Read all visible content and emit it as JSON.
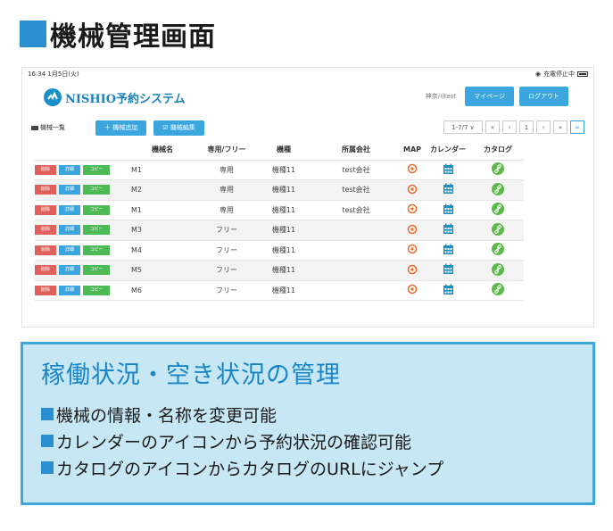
{
  "page_title": "機械管理画面",
  "statusbar": {
    "time": "16:34",
    "date": "1月5日(火)",
    "status": "充電停止中"
  },
  "app": {
    "logo_text": "NISHIO予約システム",
    "user": "神奈川test",
    "mypage_label": "マイページ",
    "logout_label": "ログアウト"
  },
  "toolbar": {
    "list_label": "機械一覧",
    "add_label": "＋ 機械追加",
    "edit_label": "☑ 機械編集",
    "range_label": "1-7/7 ∨",
    "first": "«",
    "prev": "‹",
    "page": "1",
    "next": "›",
    "last": "»"
  },
  "table": {
    "headers": [
      "機械名",
      "専用/フリー",
      "機種",
      "所属会社",
      "MAP",
      "カレンダー",
      "カタログ"
    ],
    "actions": {
      "delete": "削除",
      "detail": "詳細",
      "copy": "コピー"
    },
    "rows": [
      {
        "name": "M1",
        "type": "専用",
        "model": "機種11",
        "company": "test会社"
      },
      {
        "name": "M2",
        "type": "専用",
        "model": "機種11",
        "company": "test会社"
      },
      {
        "name": "M1",
        "type": "専用",
        "model": "機種11",
        "company": "test会社"
      },
      {
        "name": "M3",
        "type": "フリー",
        "model": "機種11",
        "company": ""
      },
      {
        "name": "M4",
        "type": "フリー",
        "model": "機種11",
        "company": ""
      },
      {
        "name": "M5",
        "type": "フリー",
        "model": "機種11",
        "company": ""
      },
      {
        "name": "M6",
        "type": "フリー",
        "model": "機種11",
        "company": ""
      }
    ]
  },
  "info": {
    "title": "稼働状況・空き状況の管理",
    "features": [
      "機械の情報・名称を変更可能",
      "カレンダーのアイコンから予約状況の確認可能",
      "カタログのアイコンからカタログのURLにジャンプ"
    ]
  },
  "colors": {
    "accent": "#3aa6dd",
    "delete": "#e0605a",
    "copy": "#4cbb55",
    "map": "#ef6a2d",
    "calendar": "#1e8fbe",
    "catalog": "#5cb94a",
    "info_bg": "#c7e7f5"
  }
}
